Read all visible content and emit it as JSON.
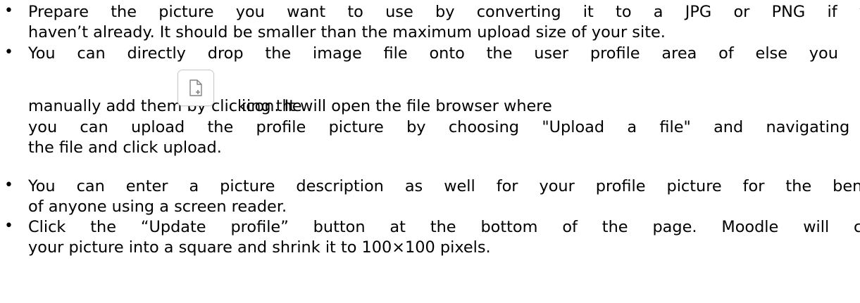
{
  "list": {
    "item1": {
      "line1": "Prepare the picture you want to use by converting it to a JPG or PNG if you",
      "line2": "haven’t already. It should be smaller than the maximum upload size of your site."
    },
    "item2": {
      "line1": "You can directly drop the image file onto the user profile area of else you can",
      "line2_before": "manually add them by clicking the",
      "line2_after": "icon. It will open the file browser where",
      "line3": "you can upload the profile picture by choosing \"Upload a file\" and navigating to",
      "line4": "the file and click upload.",
      "icon": "add-file-icon"
    },
    "item3": {
      "line1": "You can enter a picture description as well for your profile picture for the benefit",
      "line2": "of anyone using a screen reader."
    },
    "item4": {
      "line1": "Click the “Update profile” button at the bottom of the page. Moodle will crop",
      "line2": "your picture into a square and shrink it to 100×100 pixels."
    }
  },
  "colors": {
    "text": "#000000",
    "icon_border": "#c9c9c9",
    "icon_stroke": "#808080"
  }
}
